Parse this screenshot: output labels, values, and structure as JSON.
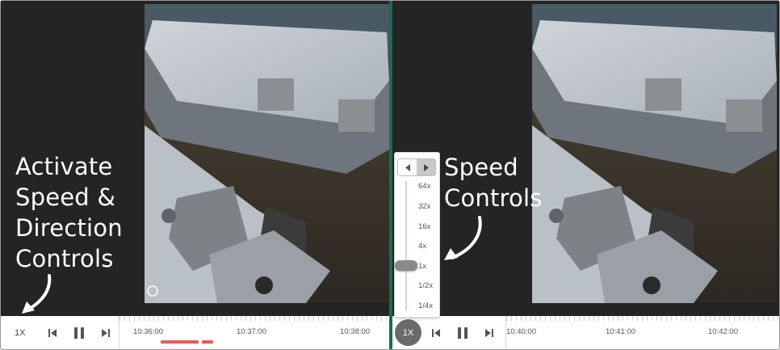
{
  "left_panel": {
    "caption_lines": [
      "Activate",
      "Speed &",
      "Direction",
      "Controls"
    ],
    "controls": {
      "speed_label": "1X",
      "icons": [
        "skip-back-icon",
        "pause-icon",
        "skip-forward-icon"
      ]
    },
    "timeline": {
      "times": [
        "10:36:00",
        "10:37:00",
        "10:38:00"
      ]
    }
  },
  "right_panel": {
    "caption_lines": [
      "Speed",
      "Controls"
    ],
    "controls": {
      "speed_label": "1X",
      "icons": [
        "skip-back-icon",
        "pause-icon",
        "skip-forward-icon"
      ]
    },
    "timeline": {
      "times": [
        "10:40:00",
        "10:41:00",
        "10:42:00"
      ]
    },
    "speed_popup": {
      "direction": [
        "reverse",
        "forward"
      ],
      "active_direction": "forward",
      "options": [
        "64x",
        "32x",
        "16x",
        "4x",
        "1x",
        "1/2x",
        "1/4x"
      ],
      "selected": "1x"
    }
  },
  "colors": {
    "divider": "#1f6b4d",
    "recording": "#e85a5a",
    "active_speed_button": "#6a6a6a"
  }
}
